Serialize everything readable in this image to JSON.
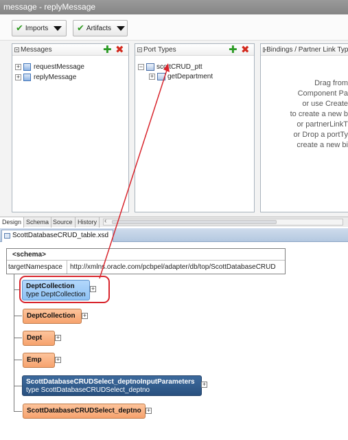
{
  "window": {
    "title": "message - replyMessage"
  },
  "toolbar": {
    "imports_label": "Imports",
    "artifacts_label": "Artifacts"
  },
  "messages_pane": {
    "title": "Messages",
    "items": [
      {
        "label": "requestMessage"
      },
      {
        "label": "replyMessage"
      }
    ]
  },
  "port_types_pane": {
    "title": "Port Types",
    "port_type": "scottCRUD_ptt",
    "operation": "getDepartment"
  },
  "bindings_pane": {
    "title": "Bindings / Partner Link Types",
    "hint_lines": [
      "Drag from",
      "Component Pa",
      "or use Create",
      "to create a new b",
      "or partnerLinkT",
      "or Drop a portTy",
      "create a new bi"
    ]
  },
  "bottom_tabs": [
    {
      "label": "Design",
      "active": true
    },
    {
      "label": "Schema"
    },
    {
      "label": "Source"
    },
    {
      "label": "History"
    }
  ],
  "file_tab": {
    "label": "ScottDatabaseCRUD_table.xsd"
  },
  "schema": {
    "title": "<schema>",
    "target_ns_key": "targetNamespace",
    "target_ns_value": "http://xmlns.oracle.com/pcbpel/adapter/db/top/ScottDatabaseCRUD"
  },
  "elements": [
    {
      "name": "DeptCollection",
      "type": "type DeptCollection",
      "style": "blue-light"
    },
    {
      "name": "DeptCollection",
      "style": "orange"
    },
    {
      "name": "Dept",
      "style": "orange"
    },
    {
      "name": "Emp",
      "style": "orange"
    },
    {
      "name": "ScottDatabaseCRUDSelect_deptnoInputParameters",
      "type": "type ScottDatabaseCRUDSelect_deptno",
      "style": "blue-dark"
    },
    {
      "name": "ScottDatabaseCRUDSelect_deptno",
      "style": "orange"
    }
  ],
  "colors": {
    "annotation_red": "#d8242c",
    "element_orange": "#f6a26d",
    "element_blue": "#8ec2f4",
    "element_dark_blue": "#29517f"
  }
}
